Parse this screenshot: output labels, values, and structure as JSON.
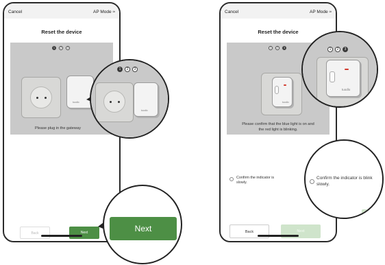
{
  "screens": [
    {
      "cancel": "Cancel",
      "mode": "AP Mode ≈",
      "title": "Reset the device",
      "steps": [
        "1",
        "2",
        "3"
      ],
      "instruction": "Please plug in the gateway",
      "back": "Back",
      "next": "Next"
    },
    {
      "cancel": "Cancel",
      "mode": "AP Mode ≈",
      "title": "Reset the device",
      "steps": [
        "1",
        "2",
        "3"
      ],
      "instruction_line1": "Please confirm that the blue light is on and",
      "instruction_line2": "the red light is blinking.",
      "option1_line1": "Confirm the indicator is",
      "option1_line2": "slowly.",
      "back": "Back",
      "next": "Next"
    }
  ],
  "zoom_callouts": {
    "next": "Next",
    "option_line1": "Confirm the indicator is blink",
    "option_line2": "slowly."
  },
  "device": {
    "brand": "tuodlo"
  },
  "colors": {
    "accent_green": "#4d8f45",
    "indicator_red": "#d23a2e"
  }
}
